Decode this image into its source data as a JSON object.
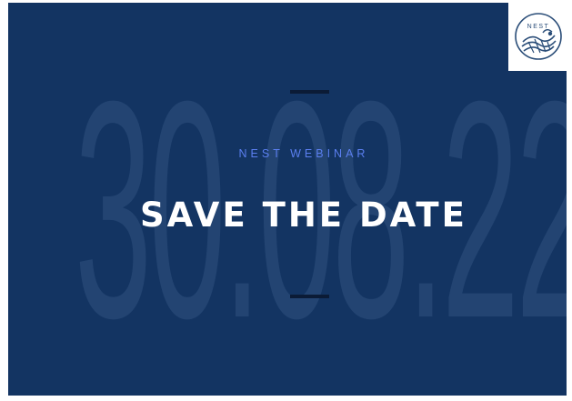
{
  "background_date": "30.08.22",
  "eyebrow": "NEST WEBINAR",
  "headline": "SAVE THE DATE",
  "logo": {
    "text": "NEST"
  },
  "colors": {
    "background": "#133462",
    "accent": "#5b7ff0",
    "headline": "#ffffff",
    "logo": "#2a4d78"
  }
}
